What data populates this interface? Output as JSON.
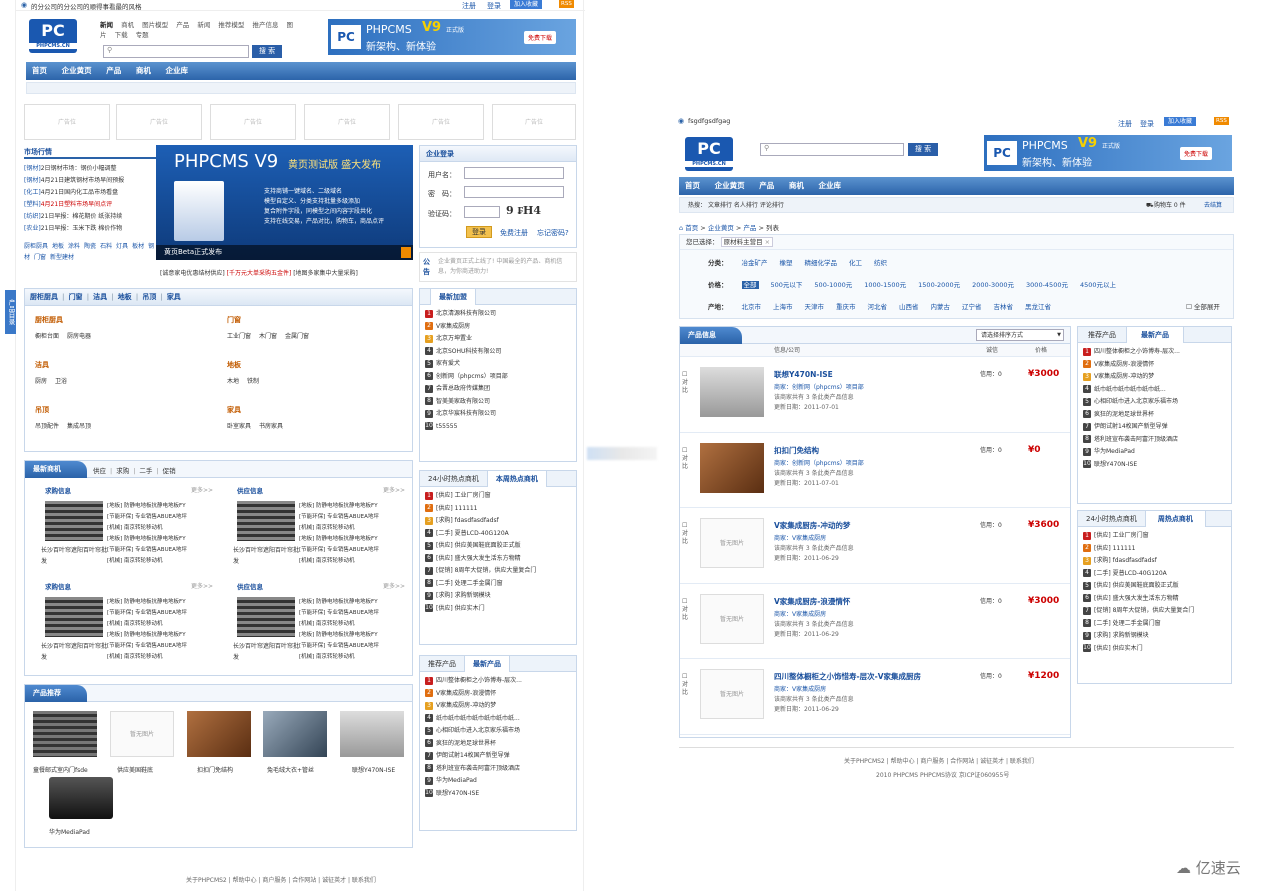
{
  "left": {
    "site_name": "的分公司的分公司的顺得事看最的风格",
    "top_links": [
      "注册",
      "登录",
      "加入收藏",
      "RSS"
    ],
    "quicknav_row1": [
      "新闻",
      "商机",
      "图片模型",
      "产品",
      "新闻",
      "推荐模型",
      "推产信息",
      "图"
    ],
    "quicknav_row2": [
      "片",
      "下载",
      "专题"
    ],
    "logo_text": "PHPCMS.CN",
    "search_btn": "搜 索",
    "banner": {
      "title": "PHPCMS",
      "version": "V9",
      "sub": "正式版",
      "slogan": "新架构、新体验",
      "download": "免费下载"
    },
    "nav": [
      "首页",
      "企业黄页",
      "产品",
      "商机",
      "企业库"
    ],
    "ad_label": "广告位",
    "market_title": "市场行情",
    "market_items": [
      {
        "t": "[钢材]",
        "c": "2日钢材市场：钢价小幅调整",
        "red": false
      },
      {
        "t": "[钢材]",
        "c": "4月21日建筑钢材市场早间预报",
        "red": false
      },
      {
        "t": "[化工]",
        "c": "4月21日国内化工品市场看盘",
        "red": false
      },
      {
        "t": "[塑料]",
        "c": "4月21日塑料市场早间点评",
        "red": true
      },
      {
        "t": "[纺织]",
        "c": "21日早报：棉花期价 纸张持续",
        "red": false
      },
      {
        "t": "[农业]",
        "c": "21日早报：玉米下跌 棉价作物",
        "red": false
      }
    ],
    "market_tags": [
      "厨柜厨具",
      "地板",
      "涂料",
      "陶瓷",
      "石料",
      "灯具",
      "板材",
      "钢材",
      "门窗",
      "新型建材"
    ],
    "promo": {
      "title": "PHPCMS V9",
      "sub": "黄页测试版 盛大发布",
      "lines": [
        "支持商铺一键域名、二级域名",
        "模型自定义、分类支持批量多级添加",
        "复合附件字段，同模型之间内容字段共化",
        "支持在线交易，产品对比，购物车，商品点评"
      ],
      "caption": "黄页Beta正式发布"
    },
    "promo_links": [
      "[诚意家电优惠结材供应]",
      "[千万元大单采购五金件]",
      "[地图多家集中大量采购]"
    ],
    "login": {
      "title": "企业登录",
      "user": "用户名：",
      "pwd": "密　码：",
      "code": "验证码：",
      "captcha": "9 ₣H4",
      "login_btn": "登录",
      "register": "免费注册",
      "forgot": "忘记密码?"
    },
    "notice": {
      "label": "公告",
      "text": "企业黄页正式上线了! 中国最全的产品、商机信息，为你商进助力!"
    },
    "side_tab": "产品目录",
    "cat_tabs": [
      "厨柜厨具",
      "门窗",
      "洁具",
      "地板",
      "吊顶",
      "家具"
    ],
    "cats": [
      {
        "name": "厨柜厨具",
        "items": [
          "橱柜台面",
          "厨房电器"
        ]
      },
      {
        "name": "门窗",
        "items": [
          "工业门窗",
          "木门窗",
          "金属门窗"
        ]
      },
      {
        "name": "洁具",
        "items": [
          "厨房",
          "卫浴"
        ]
      },
      {
        "name": "地板",
        "items": [
          "木地",
          "铁制"
        ]
      },
      {
        "name": "吊顶",
        "items": [
          "吊顶配件",
          "集成吊顶"
        ]
      },
      {
        "name": "家具",
        "items": [
          "卧室家具",
          "书房家具"
        ]
      }
    ],
    "latest_join_title": "最新加盟",
    "latest_join": [
      "北京清源科技有限公司",
      "V家集成厨房",
      "北京万坤置业",
      "北京SOHU科技有限公司",
      "家有爱犬",
      "创新网（phpcms）项目部",
      "会晋总政府传媒集团",
      "智美美家政有限公司",
      "北京华宸科技有限公司",
      "t55555"
    ],
    "biz_title": "最新商机",
    "biz_tabs": [
      "供应",
      "求购",
      "二手",
      "促销"
    ],
    "buy_title": "求购信息",
    "supply_title": "供应信息",
    "more": "更多>>",
    "biz_lines": [
      "[地板] 防静电地板抗静电地板FY",
      "[节能环保] 专业销售ABUEA地坪",
      "[机械] 南京转轮移动机"
    ],
    "thumb_caption": "长沙百叶帘遮阳百叶帘批发",
    "hot_tabs": [
      "24小时热点商机",
      "本周热点商机"
    ],
    "hot_items": [
      "[供应] 工业厂房门窗",
      "[供应] 111111",
      "[求购] fdasdfasdfadsf",
      "[二手] 夏普LCD-40G120A",
      "[供应] 供应美国鞋底面胶正式版",
      "[供应] 盛大强大发生活东方物精",
      "[促销] 8周年大促销，供应大量复合门",
      "[二手] 处理二手金属门窗",
      "[求购] 求购新钢模块",
      "[供应] 供应实木门"
    ],
    "prod_title": "产品推荐",
    "prod_items": [
      "童餐邮式室内门fsde",
      "供应美国鞋底",
      "扣扣门免结构",
      "兔毛绒大衣+管丝",
      "联想Y470N-ISE",
      "华为MediaPad"
    ],
    "rec_tabs": [
      "推荐产品",
      "最新产品"
    ],
    "rec_items": [
      "四川整体橱柜之小饰博寿-层次...",
      "V家集成厨房-浪漫情怀",
      "V家集成厨房-冲动的梦",
      "纸巾纸巾纸巾纸巾纸巾纸巾纸...",
      "心相印纸巾进入北京家乐福市场",
      "疯狂的泥地足球世界杯",
      "伊朗试射14枚国产新型导弹",
      "塔利班宣布袭击阿富汗顶级酒店",
      "华为MediaPad",
      "联想Y470N-ISE"
    ],
    "footer": "关于PHPCMS2 | 帮助中心 | 商户服务 | 合作网站 | 诚征英才 | 联系我们"
  },
  "right": {
    "site_name": "fsgdfgsdfgag",
    "top_links": [
      "注册",
      "登录",
      "加入收藏",
      "RSS"
    ],
    "search_btn": "搜 索",
    "nav": [
      "首页",
      "企业黄页",
      "产品",
      "商机",
      "企业库"
    ],
    "hot_label": "热搜：",
    "hot_links": [
      "文章排行",
      "名人排行",
      "评论排行"
    ],
    "cart": "购物车 0 件",
    "checkout": "去结算",
    "crumbs": [
      "首页",
      "企业黄页",
      "产品",
      "列表"
    ],
    "selected_label": "您已选择：",
    "selected_chip": "原材料主营目",
    "cat_label": "分类：",
    "cat_values": [
      "冶金矿产",
      "橡塑",
      "精细化学品",
      "化工",
      "纺织"
    ],
    "price_label": "价格：",
    "price_values": [
      "全部",
      "500元以下",
      "500-1000元",
      "1000-1500元",
      "1500-2000元",
      "2000-3000元",
      "3000-4500元",
      "4500元以上"
    ],
    "area_label": "产地：",
    "area_values": [
      "北京市",
      "上海市",
      "天津市",
      "重庆市",
      "河北省",
      "山西省",
      "内蒙古",
      "辽宁省",
      "吉林省",
      "黑龙江省"
    ],
    "expand": "全部展开",
    "info_title": "产品信息",
    "sort_label": "请选择排序方式",
    "cols": [
      "信息/公司",
      "诚信",
      "价格"
    ],
    "compare": "对比",
    "noimg": "暂无图片",
    "products": [
      {
        "name": "联想Y470N-ISE",
        "shop": "商家：创新网（phpcms）项目部",
        "count": "该商家共有 3 条此类产品信息",
        "date": "更新日期：2011-07-01",
        "credit": "信用：0",
        "price": "¥3000",
        "img": "laptop"
      },
      {
        "name": "扣扣门免结构",
        "shop": "商家：创新网（phpcms）项目部",
        "count": "该商家共有 3 条此类产品信息",
        "date": "更新日期：2011-07-01",
        "credit": "信用：0",
        "price": "¥0",
        "img": "photo"
      },
      {
        "name": "V家集成厨房-冲动的梦",
        "shop": "商家：V家集成厨房",
        "count": "该商家共有 3 条此类产品信息",
        "date": "更新日期：2011-06-29",
        "credit": "信用：0",
        "price": "¥3600",
        "img": "none"
      },
      {
        "name": "V家集成厨房-浪漫情怀",
        "shop": "商家：V家集成厨房",
        "count": "该商家共有 3 条此类产品信息",
        "date": "更新日期：2011-06-29",
        "credit": "信用：0",
        "price": "¥3000",
        "img": "none"
      },
      {
        "name": "四川整体橱柜之小饰惜寿-层次-V家集成厨房",
        "shop": "商家：V家集成厨房",
        "count": "该商家共有 3 条此类产品信息",
        "date": "更新日期：2011-06-29",
        "credit": "信用：0",
        "price": "¥1200",
        "img": "none"
      }
    ],
    "side_tabs": [
      "推荐产品",
      "最新产品"
    ],
    "side_items": [
      "四川整体橱柜之小饰博寿-层次...",
      "V家集成厨房-浪漫情怀",
      "V家集成厨房-冲动的梦",
      "纸巾纸巾纸巾纸巾纸巾纸...",
      "心相印纸巾进入北京家乐福市场",
      "疯狂的泥地足球世界杯",
      "伊朗试射14枚国产新型导弹",
      "塔利班宣布袭击阿富汗顶级酒店",
      "华为MediaPad",
      "联想Y470N-ISE"
    ],
    "hot_tabs": [
      "24小时热点商机",
      "周热点商机"
    ],
    "hot_items": [
      "[供应] 工业厂房门窗",
      "[供应] 111111",
      "[求购] fdasdfasdfadsf",
      "[二手] 夏普LCD-40G120A",
      "[供应] 供应美国鞋底面胶正式版",
      "[供应] 盛大强大发生活东方物精",
      "[促销] 8周年大促销，供应大量复合门",
      "[二手] 处理二手金属门窗",
      "[求购] 求购新钢模块",
      "[供应] 供应实木门"
    ],
    "footer1": "关于PHPCMS2 | 帮助中心 | 商户服务 | 合作网站 | 诚征英才 | 联系我们",
    "footer2": "2010 PHPCMS PHPCMS协议 京ICP证060955号"
  },
  "watermark": "亿速云"
}
